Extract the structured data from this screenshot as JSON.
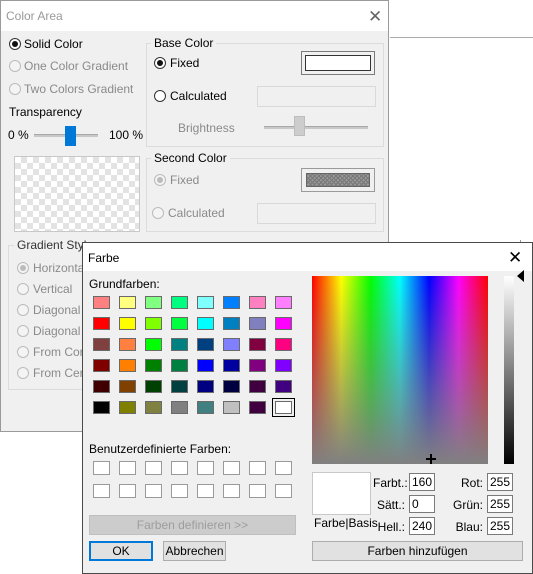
{
  "color_area": {
    "title": "Color Area",
    "fill_types": [
      "Solid Color",
      "One Color Gradient",
      "Two Colors Gradient"
    ],
    "transparency_label": "Transparency",
    "transparency_min": "0 %",
    "transparency_max": "100 %",
    "base_color": {
      "title": "Base Color",
      "fixed": "Fixed",
      "calculated": "Calculated",
      "brightness": "Brightness"
    },
    "second_color": {
      "title": "Second Color",
      "fixed": "Fixed",
      "calculated": "Calculated"
    },
    "gradient_style": {
      "title": "Gradient Style",
      "options": [
        "Horizontal",
        "Vertical",
        "Diagonal D",
        "Diagonal U",
        "From Corne",
        "From Cente"
      ]
    }
  },
  "farbe": {
    "title": "Farbe",
    "basic_colors_label": "Grundfarben:",
    "basic_colors": [
      [
        "#ff8080",
        "#ffff80",
        "#80ff80",
        "#00ff80",
        "#80ffff",
        "#0080ff",
        "#ff80c0",
        "#ff80ff"
      ],
      [
        "#ff0000",
        "#ffff00",
        "#80ff00",
        "#00ff40",
        "#00ffff",
        "#0080c0",
        "#8080c0",
        "#ff00ff"
      ],
      [
        "#804040",
        "#ff8040",
        "#00ff00",
        "#008080",
        "#004080",
        "#8080ff",
        "#800040",
        "#ff0080"
      ],
      [
        "#800000",
        "#ff8000",
        "#008000",
        "#008040",
        "#0000ff",
        "#0000a0",
        "#800080",
        "#8000ff"
      ],
      [
        "#400000",
        "#804000",
        "#004000",
        "#004040",
        "#000080",
        "#000040",
        "#400040",
        "#400080"
      ],
      [
        "#000000",
        "#808000",
        "#808040",
        "#808080",
        "#408080",
        "#c0c0c0",
        "#400040",
        "#ffffff"
      ]
    ],
    "custom_colors_label": "Benutzerdefinierte Farben:",
    "define_button": "Farben definieren >>",
    "ok_button": "OK",
    "cancel_button": "Abbrechen",
    "preview_label": "Farbe|Basis",
    "add_button": "Farben hinzufügen",
    "hue_label": "Farbt.:",
    "hue_value": "160",
    "sat_label": "Sätt.:",
    "sat_value": "0",
    "lum_label": "Hell.:",
    "lum_value": "240",
    "red_label": "Rot:",
    "red_value": "255",
    "green_label": "Grün:",
    "green_value": "255",
    "blue_label": "Blau:",
    "blue_value": "255"
  }
}
